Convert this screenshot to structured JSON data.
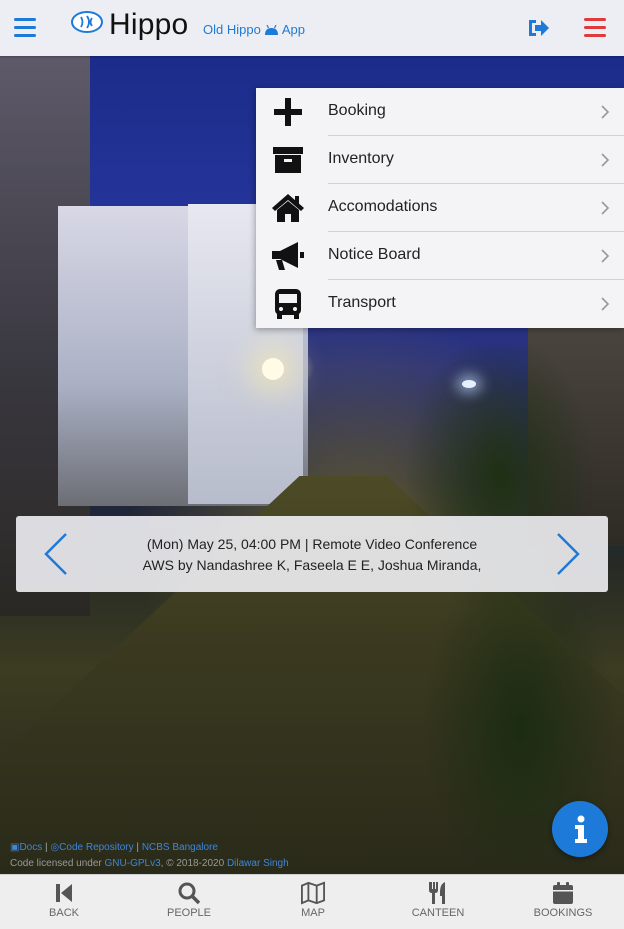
{
  "header": {
    "brand": "Hippo",
    "old_app_link": "Old Hippo",
    "old_app_link_suffix": "App"
  },
  "menu": {
    "items": [
      {
        "label": "Booking",
        "icon": "plus-icon"
      },
      {
        "label": "Inventory",
        "icon": "archive-icon"
      },
      {
        "label": "Accomodations",
        "icon": "home-icon"
      },
      {
        "label": "Notice Board",
        "icon": "megaphone-icon"
      },
      {
        "label": "Transport",
        "icon": "bus-icon"
      }
    ]
  },
  "event": {
    "line1": "(Mon) May 25, 04:00 PM | Remote Video Conference",
    "line2": "AWS by Nandashree K, Faseela E E, Joshua Miranda,"
  },
  "credits": {
    "docs": "Docs",
    "repo": "Code Repository",
    "org": "NCBS Bangalore",
    "license_prefix": "Code licensed under",
    "license_name": "GNU-GPLv3",
    "license_year": ", © 2018-2020",
    "author": "Dilawar Singh"
  },
  "bottom_nav": [
    {
      "label": "BACK",
      "icon": "back-icon"
    },
    {
      "label": "PEOPLE",
      "icon": "search-icon"
    },
    {
      "label": "MAP",
      "icon": "map-icon"
    },
    {
      "label": "CANTEEN",
      "icon": "utensils-icon"
    },
    {
      "label": "BOOKINGS",
      "icon": "calendar-icon"
    }
  ],
  "colors": {
    "accent": "#1e7ad8",
    "danger": "#e03a3a",
    "topbar_bg": "#eceef3"
  }
}
